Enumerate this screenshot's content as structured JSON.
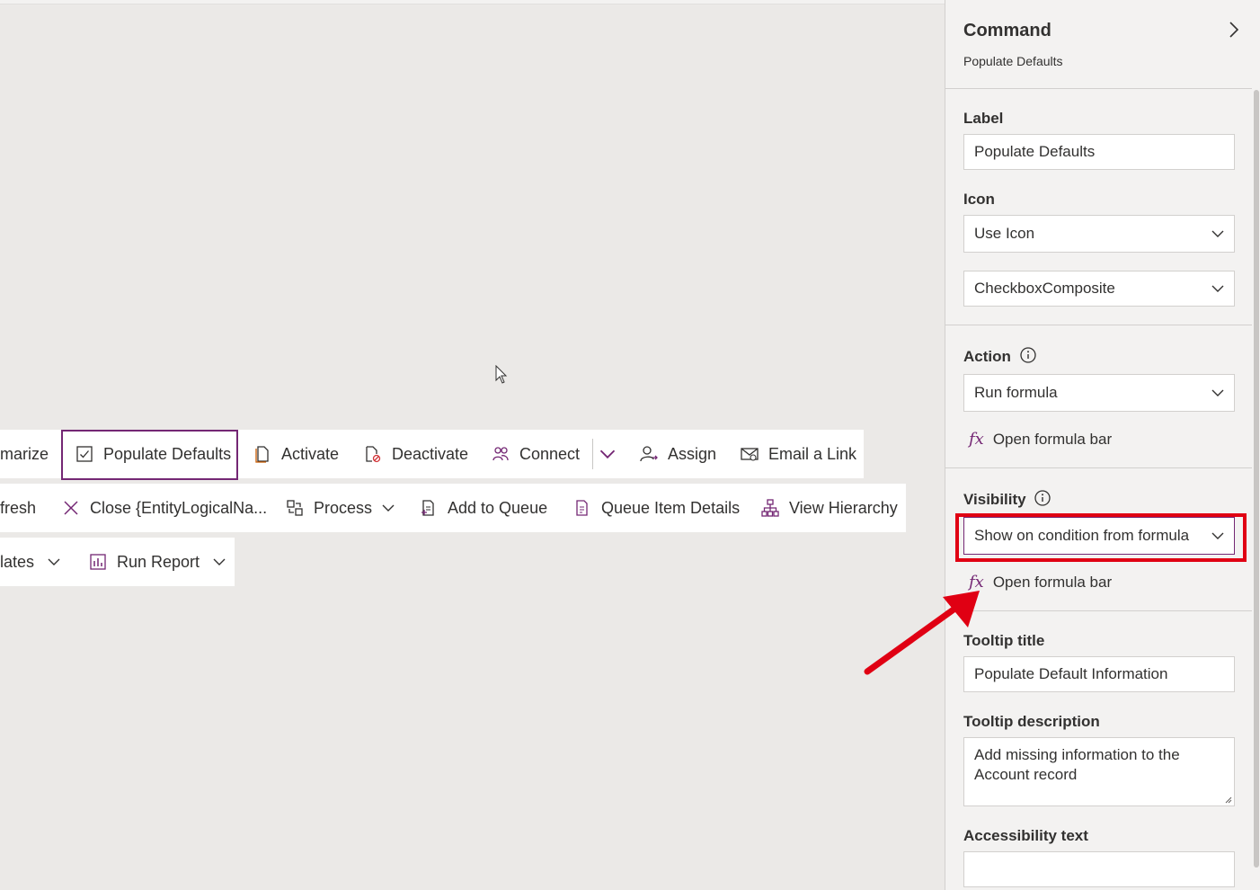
{
  "canvas": {
    "row1": {
      "summarize": "marize",
      "populate_defaults": "Populate Defaults",
      "activate": "Activate",
      "deactivate": "Deactivate",
      "connect": "Connect",
      "assign": "Assign",
      "email_link": "Email a Link"
    },
    "row2": {
      "refresh": "fresh",
      "close": "Close {EntityLogicalNa...",
      "process": "Process",
      "add_to_queue": "Add to Queue",
      "queue_item_details": "Queue Item Details",
      "view_hierarchy": "View Hierarchy"
    },
    "row3": {
      "templates": "lates",
      "run_report": "Run Report"
    }
  },
  "panel": {
    "title": "Command",
    "subtitle": "Populate Defaults",
    "label_title": "Label",
    "label_value": "Populate Defaults",
    "icon_title": "Icon",
    "icon_mode": "Use Icon",
    "icon_name": "CheckboxComposite",
    "action_title": "Action",
    "action_value": "Run formula",
    "open_formula_bar_1": "Open formula bar",
    "visibility_title": "Visibility",
    "visibility_value": "Show on condition from formula",
    "open_formula_bar_2": "Open formula bar",
    "tooltip_title_label": "Tooltip title",
    "tooltip_title_value": "Populate Default Information",
    "tooltip_desc_label": "Tooltip description",
    "tooltip_desc_value": "Add missing information to the Account record",
    "accessibility_label": "Accessibility text",
    "accessibility_value": ""
  },
  "colors": {
    "accent": "#742774",
    "highlight": "#e00013",
    "canvas_bg": "#ebe9e7",
    "panel_bg": "#f3f2f1"
  },
  "icons": [
    "checkbox-composite-icon",
    "activate-icon",
    "deactivate-icon",
    "connect-icon",
    "assign-icon",
    "email-icon",
    "close-icon",
    "process-icon",
    "add-to-queue-icon",
    "queue-item-icon",
    "hierarchy-icon",
    "report-icon",
    "chevron-down-icon",
    "chevron-right-icon",
    "info-icon",
    "fx-icon"
  ]
}
